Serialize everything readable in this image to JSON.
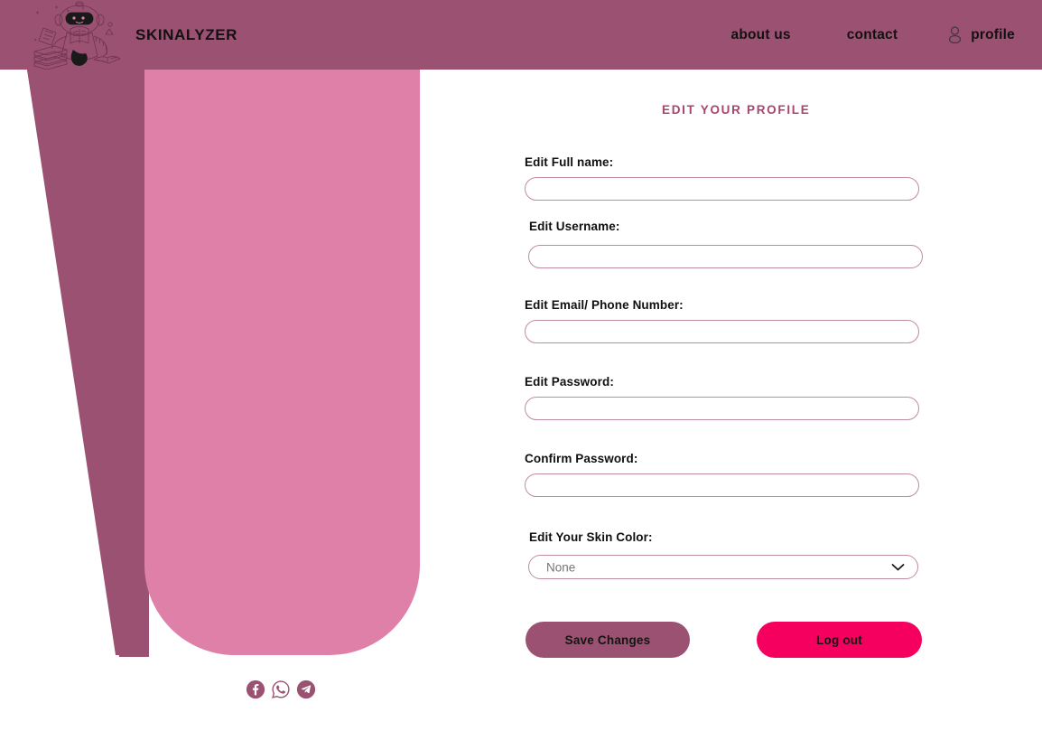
{
  "header": {
    "brand": "SKINALYZER",
    "logo_icon": "robot-reading-books-logo",
    "nav": [
      {
        "label": "about us",
        "name": "about-us"
      },
      {
        "label": "contact",
        "name": "contact"
      },
      {
        "label": "profile",
        "name": "profile",
        "icon": "person-icon"
      }
    ]
  },
  "form": {
    "title": "EDIT YOUR PROFILE",
    "fields": [
      {
        "label": "Edit Full name:",
        "value": "",
        "placeholder": ""
      },
      {
        "label": "Edit Username:",
        "value": "",
        "placeholder": ""
      },
      {
        "label": "Edit Email/ Phone Number:",
        "value": "",
        "placeholder": ""
      },
      {
        "label": "Edit Password:",
        "value": "",
        "placeholder": ""
      },
      {
        "label": "Confirm Password:",
        "value": "",
        "placeholder": ""
      }
    ],
    "skin_color": {
      "label": "Edit Your Skin Color:",
      "selected": "None",
      "chevron_icon": "chevron-down-icon"
    },
    "buttons": {
      "save": "Save Changes",
      "logout": "Log out"
    }
  },
  "socials": [
    {
      "name": "facebook-icon"
    },
    {
      "name": "whatsapp-icon"
    },
    {
      "name": "telegram-icon"
    }
  ],
  "colors": {
    "header_mauve": "#9b5171",
    "panel_pink": "#de80a8",
    "accent_magenta": "#f5005e",
    "title_mauve": "#a8446e",
    "border_mauve": "#c08ca4"
  }
}
